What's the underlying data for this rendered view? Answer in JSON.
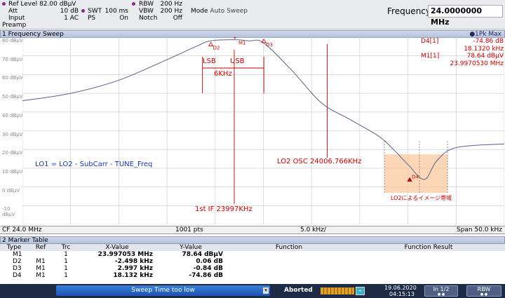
{
  "header": {
    "ref_level_label": "Ref Level",
    "ref_level_value": "82.00 dBµV",
    "att_label": "Att",
    "att_value": "10 dB",
    "input_label": "Input",
    "input_value": "1 AC",
    "preamp_label": "Preamp",
    "swt_label": "SWT",
    "swt_value": "100 ms",
    "ps_label": "PS",
    "ps_value": "On",
    "rbw_label": "RBW",
    "rbw_value": "200 Hz",
    "vbw_label": "VBW",
    "vbw_value": "200 Hz",
    "notch_label": "Notch",
    "notch_value": "Off",
    "mode_label": "Mode",
    "mode_value": "Auto Sweep",
    "frequency_label": "Frequency",
    "frequency_value": "24.0000000 MHz"
  },
  "sweep_window": {
    "title": "1 Frequency Sweep",
    "detector": "●1Pk Max",
    "marker_readout": {
      "d4_label": "D4[1]",
      "d4_level": "-74.86 dB",
      "d4_freq": "18.1320 kHz",
      "m1_label": "M1[1]",
      "m1_level": "78.64 dBµV",
      "m1_freq": "23.9970530 MHz"
    },
    "marker_names": [
      "D2",
      "M1",
      "D3",
      "D4"
    ],
    "annotations": {
      "lsb": "LSB",
      "usb": "USB",
      "bw": "6KHz",
      "lo1_formula": "LO1 = LO2 - SubCarr - TUNE_Freq",
      "lo2_osc": "LO2 OSC 24006.766KHz",
      "first_if": "1st IF 23997KHz",
      "image_band": "LO2によるイメージ帯域"
    },
    "footer": {
      "cf": "CF 24.0 MHz",
      "points": "1001 pts",
      "div": "5.0 kHz/",
      "span": "Span 50.0 kHz"
    }
  },
  "chart_data": {
    "type": "line",
    "title": "1 Frequency Sweep",
    "xlabel": "",
    "ylabel": "dBµV",
    "xlim": [
      23.975,
      24.025
    ],
    "ylim": [
      -20,
      80
    ],
    "y_ticks": [
      "80 dBµV",
      "70 dBµV",
      "60 dBµV",
      "50 dBµV",
      "40 dBµV",
      "30 dBµV",
      "20 dBµV",
      "10 dBµV",
      "0 dBµV",
      "-10 dBµV"
    ],
    "series": [
      {
        "x": [
          23.975,
          23.98,
          23.985,
          23.99,
          23.993,
          23.9945,
          23.997,
          23.9985,
          24.0,
          24.003,
          24.006,
          24.009,
          24.012,
          24.0135,
          24.015,
          24.0167,
          24.018,
          24.02,
          24.025
        ],
        "values": [
          46,
          50,
          57,
          68,
          75,
          78,
          78.64,
          78,
          77,
          62,
          45,
          36,
          27,
          20,
          12,
          4,
          14,
          21,
          23
        ]
      }
    ],
    "markers": [
      {
        "name": "D2",
        "x": 23.99455,
        "y": 76.1
      },
      {
        "name": "M1",
        "x": 23.99705,
        "y": 78.64
      },
      {
        "name": "D3",
        "x": 24.00005,
        "y": 77.8
      },
      {
        "name": "D4",
        "x": 24.01518,
        "y": 3.8
      }
    ],
    "grid": true
  },
  "marker_table": {
    "title": "2 Marker Table",
    "columns": [
      "Type",
      "Ref",
      "Trc",
      "X-Value",
      "Y-Value",
      "Function",
      "Function Result"
    ],
    "rows": [
      [
        "M1",
        "",
        "1",
        "23.997053 MHz",
        "78.64 dBµV",
        "",
        ""
      ],
      [
        "D2",
        "M1",
        "1",
        "-2.498 kHz",
        "0.06 dB",
        "",
        ""
      ],
      [
        "D3",
        "M1",
        "1",
        "2.997 kHz",
        "-0.84 dB",
        "",
        ""
      ],
      [
        "D4",
        "M1",
        "1",
        "18.132 kHz",
        "-74.86 dB",
        "",
        ""
      ]
    ]
  },
  "statusbar": {
    "message": "Sweep Time too low",
    "state": "Aborted",
    "date": "19.06.2020",
    "time": "04:15:13",
    "page": "In 1/2",
    "rbw_badge": "RBW"
  }
}
